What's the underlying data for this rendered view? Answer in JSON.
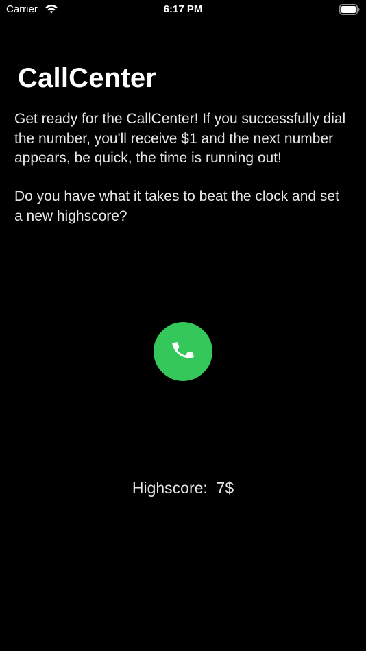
{
  "status_bar": {
    "carrier": "Carrier",
    "time": "6:17 PM",
    "wifi_icon": "wifi-icon",
    "battery_icon": "battery-icon"
  },
  "screen": {
    "title": "CallCenter",
    "intro": "Get ready for the CallCenter! If you successfully dial the number, you'll receive $1 and the next number appears, be quick, the time is running out!",
    "question": "Do you have what it takes to beat the clock and set a new highscore?"
  },
  "call_button": {
    "icon": "phone-icon",
    "color": "#34c759"
  },
  "highscore": {
    "text": "Highscore:  7$"
  },
  "colors": {
    "background": "#000000",
    "text": "#ffffff",
    "accent": "#34c759"
  }
}
